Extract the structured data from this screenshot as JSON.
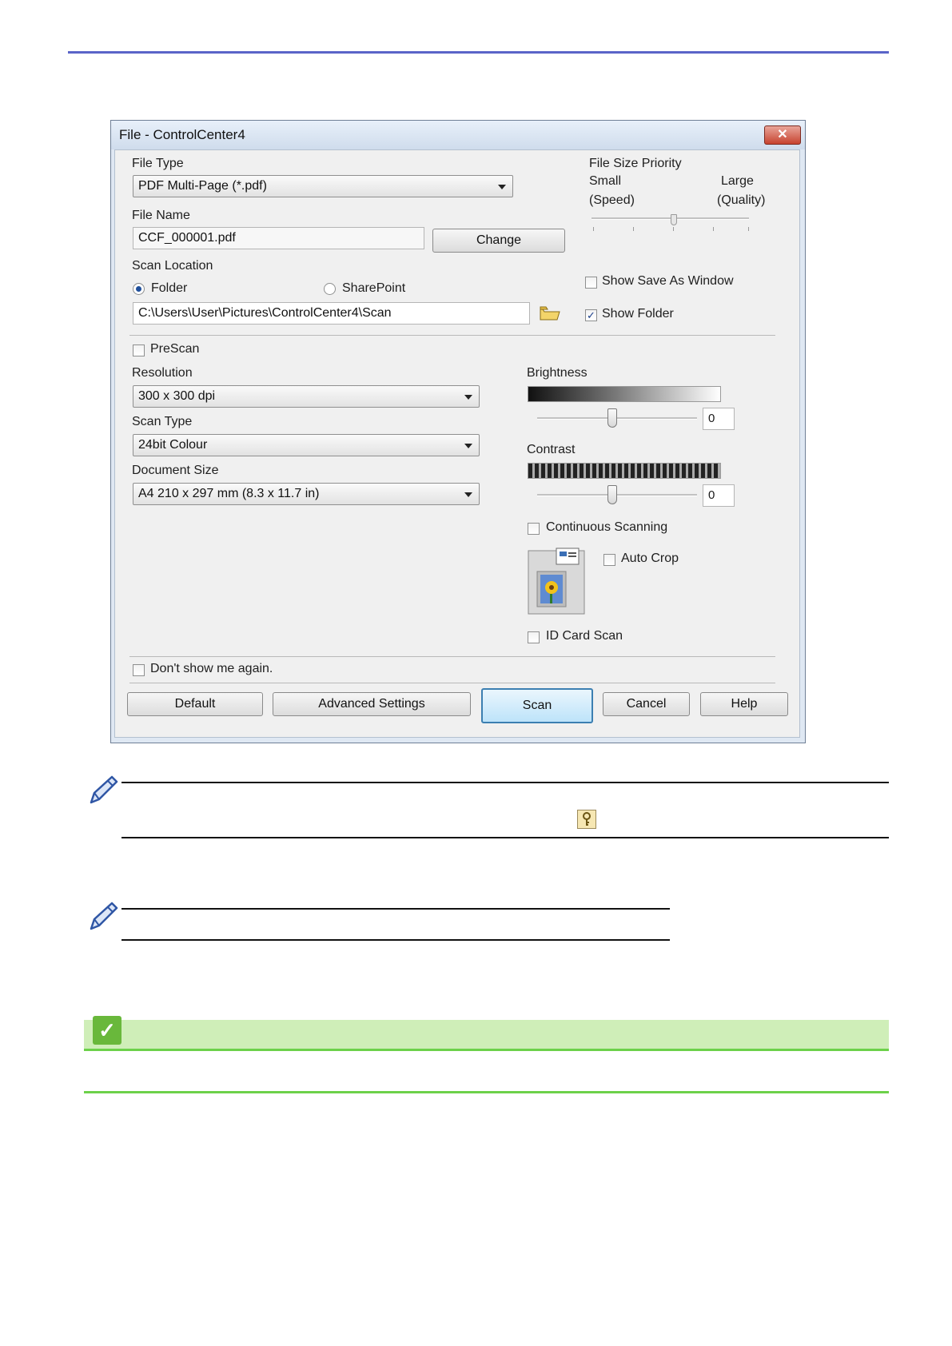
{
  "dialog": {
    "title": "File - ControlCenter4",
    "close_glyph": "✕",
    "file_type": {
      "label": "File Type",
      "value": "PDF Multi-Page (*.pdf)"
    },
    "file_size_priority": {
      "label": "File Size Priority",
      "small": "Small",
      "speed": "(Speed)",
      "large": "Large",
      "quality": "(Quality)"
    },
    "file_name": {
      "label": "File Name",
      "value": "CCF_000001.pdf",
      "change_button": "Change"
    },
    "scan_location": {
      "label": "Scan Location",
      "folder_option": "Folder",
      "sharepoint_option": "SharePoint",
      "selected": "Folder",
      "path": "C:\\Users\\User\\Pictures\\ControlCenter4\\Scan"
    },
    "show_save_as_window": {
      "label": "Show Save As Window",
      "checked": false
    },
    "show_folder": {
      "label": "Show Folder",
      "checked": true
    },
    "prescan": {
      "label": "PreScan",
      "checked": false
    },
    "resolution": {
      "label": "Resolution",
      "value": "300 x 300 dpi"
    },
    "scan_type": {
      "label": "Scan Type",
      "value": "24bit Colour"
    },
    "document_size": {
      "label": "Document Size",
      "value": "A4 210 x 297 mm (8.3 x 11.7 in)"
    },
    "brightness": {
      "label": "Brightness",
      "value": "0"
    },
    "contrast": {
      "label": "Contrast",
      "value": "0"
    },
    "continuous_scanning": {
      "label": "Continuous Scanning",
      "checked": false
    },
    "auto_crop": {
      "label": "Auto Crop",
      "checked": false
    },
    "id_card_scan": {
      "label": "ID Card Scan",
      "checked": false
    },
    "dont_show_again": {
      "label": "Don't show me again.",
      "checked": false
    },
    "buttons": {
      "default": "Default",
      "advanced": "Advanced Settings",
      "scan": "Scan",
      "cancel": "Cancel",
      "help": "Help"
    },
    "checkmark_glyph": "✓"
  },
  "icons": [
    "folder-browse-icon",
    "pencil-note-icon",
    "key-icon",
    "checkmark-icon",
    "auto-crop-preview-icon"
  ],
  "colors": {
    "top_rule": "#5a64c8",
    "accent_green": "#6cd14a",
    "green_band": "#cfeeb8"
  }
}
